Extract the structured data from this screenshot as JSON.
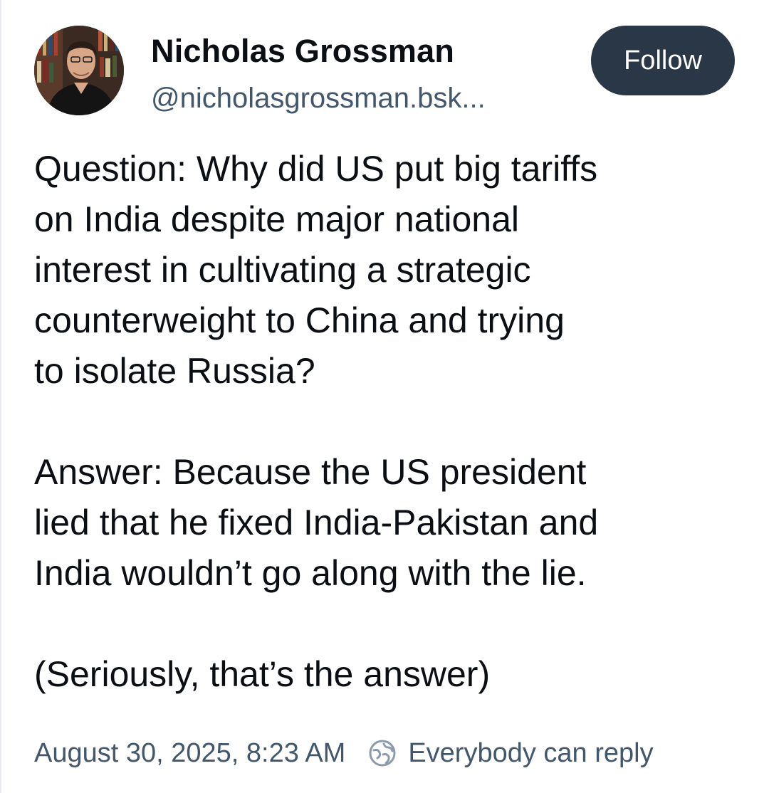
{
  "author": {
    "name": "Nicholas Grossman",
    "handle": "@nicholasgrossman.bsk...",
    "avatar_icon": "profile-photo"
  },
  "follow_button": {
    "label": "Follow"
  },
  "post": {
    "question_lines": [
      "Question: Why did US put big tariffs",
      "on India despite major national",
      "interest in cultivating a strategic",
      "counterweight to China and trying",
      "to isolate Russia?"
    ],
    "answer_lines": [
      "Answer: Because the US president",
      "lied that he fixed India-Pakistan and",
      "India wouldn’t go along with the lie."
    ],
    "closing": "(Seriously, that’s the answer)"
  },
  "footer": {
    "timestamp": "August 30, 2025, 8:23 AM",
    "reply_icon": "globe-reply-icon",
    "reply_setting": "Everybody can reply"
  },
  "colors": {
    "follow_bg": "#2a3746",
    "muted_text": "#42576c",
    "body_text": "#0b0f14"
  }
}
